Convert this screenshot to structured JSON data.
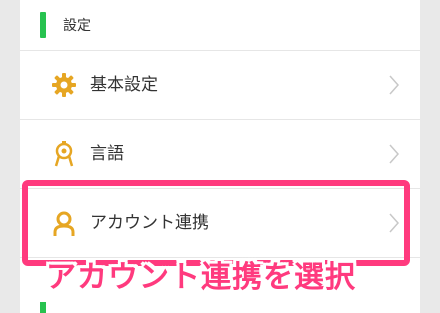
{
  "section": {
    "title": "設定"
  },
  "items": [
    {
      "label": "基本設定",
      "icon": "gear-icon"
    },
    {
      "label": "言語",
      "icon": "language-icon"
    },
    {
      "label": "アカウント連携",
      "icon": "person-icon"
    }
  ],
  "caption": {
    "text": "アカウント連携を選択"
  },
  "colors": {
    "accent_green": "#27c24f",
    "icon_gold": "#e6a623",
    "highlight_pink": "#ff3a7e"
  }
}
